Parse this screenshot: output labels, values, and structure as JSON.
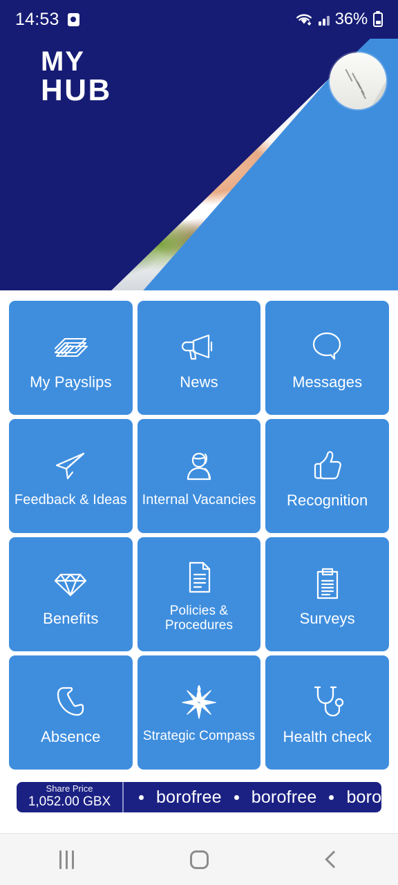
{
  "status_bar": {
    "time": "14:53",
    "alarm_icon": "alarm-icon",
    "wifi_icon": "wifi-icon",
    "signal_icon": "signal-bars-icon",
    "battery_percent": "36%",
    "battery_icon": "battery-icon"
  },
  "header": {
    "logo_line1": "MY",
    "logo_line2": "HUB",
    "avatar": "profile-avatar",
    "hero_image": "grilled-salmon-salad-photo",
    "navy": "#161c74",
    "blue": "#3f8ede"
  },
  "tiles": [
    {
      "label": "My Payslips",
      "icon": "banknotes-icon",
      "size": ""
    },
    {
      "label": "News",
      "icon": "megaphone-icon",
      "size": ""
    },
    {
      "label": "Messages",
      "icon": "speech-bubble-icon",
      "size": ""
    },
    {
      "label": "Feedback & Ideas",
      "icon": "paper-plane-icon",
      "size": "sm"
    },
    {
      "label": "Internal Vacancies",
      "icon": "person-icon",
      "size": "sm"
    },
    {
      "label": "Recognition",
      "icon": "thumbs-up-icon",
      "size": ""
    },
    {
      "label": "Benefits",
      "icon": "diamond-icon",
      "size": ""
    },
    {
      "label": "Policies &\nProcedures",
      "icon": "document-icon",
      "size": "xs"
    },
    {
      "label": "Surveys",
      "icon": "clipboard-icon",
      "size": ""
    },
    {
      "label": "Absence",
      "icon": "phone-icon",
      "size": ""
    },
    {
      "label": "Strategic Compass",
      "icon": "compass-star-icon",
      "size": "xs"
    },
    {
      "label": "Health check",
      "icon": "stethoscope-icon",
      "size": ""
    }
  ],
  "ticker": {
    "share_price_label": "Share Price",
    "share_price_value": "1,052.00 GBX",
    "feed_items": [
      "borofree",
      "borofree",
      "borofree"
    ],
    "background": "#1b2183"
  },
  "nav_bar": {
    "recents": "recents-icon",
    "home": "home-icon",
    "back": "back-icon"
  }
}
